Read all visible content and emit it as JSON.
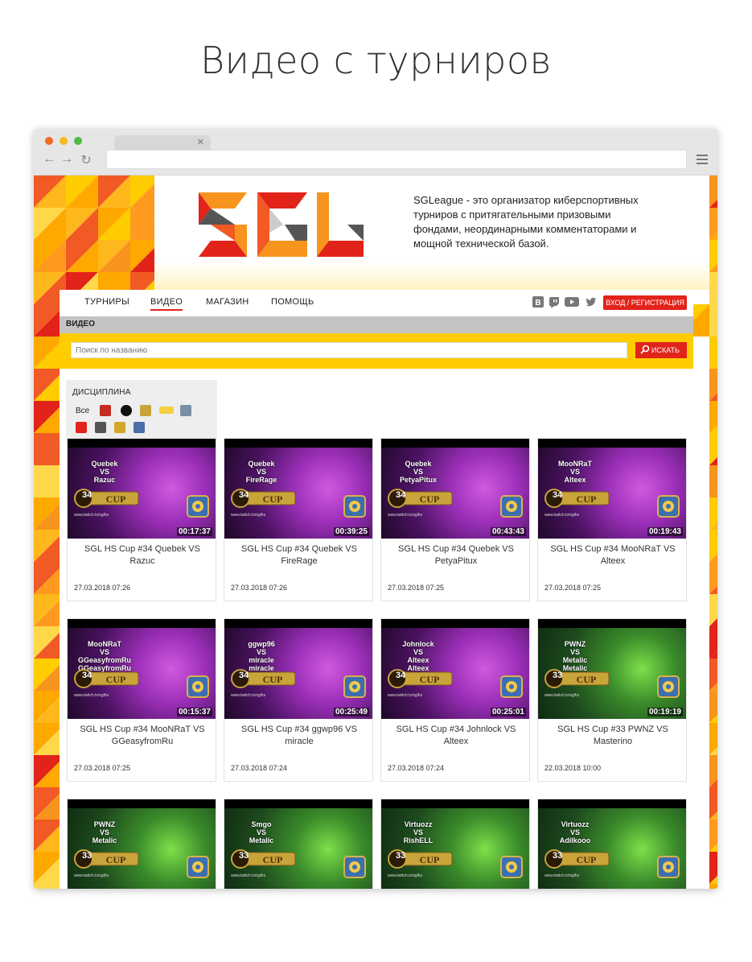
{
  "heading": "Видео с турниров",
  "site": {
    "tagline": "SGLeague - это организатор киберспортивных турниров с притягательными призовыми фондами, неординарными комментаторами и мощной технической базой.",
    "nav": [
      "ТУРНИРЫ",
      "ВИДЕО",
      "МАГАЗИН",
      "ПОМОЩЬ"
    ],
    "login_label": "ВХОД / РЕГИСТРАЦИЯ",
    "section_title": "ВИДЕО",
    "search_placeholder": "Поиск по названию",
    "search_label": "ИСКАТЬ",
    "filter_title": "ДИСЦИПЛИНА",
    "filter_all": "Все",
    "brand_color": "#e2231a",
    "accent_yellow": "#ffcc00"
  },
  "videos": [
    {
      "p1": "Quebek",
      "vs": "VS",
      "p2": "Razuc",
      "p3": "",
      "cup": "34",
      "duration": "00:17:37",
      "title": "SGL HS Cup #34 Quebek VS Razuc",
      "date": "27.03.2018 07:26",
      "theme": "purple"
    },
    {
      "p1": "Quebek",
      "vs": "VS",
      "p2": "FireRage",
      "p3": "",
      "cup": "34",
      "duration": "00:39:25",
      "title": "SGL HS Cup #34 Quebek VS FireRage",
      "date": "27.03.2018 07:26",
      "theme": "purple"
    },
    {
      "p1": "Quebek",
      "vs": "VS",
      "p2": "PetyaPitux",
      "p3": "",
      "cup": "34",
      "duration": "00:43:43",
      "title": "SGL HS Cup #34 Quebek VS PetyaPitux",
      "date": "27.03.2018 07:25",
      "theme": "purple"
    },
    {
      "p1": "MooNRaT",
      "vs": "VS",
      "p2": "Alteex",
      "p3": "",
      "cup": "34",
      "duration": "00:19:43",
      "title": "SGL HS Cup #34 MooNRaT VS Alteex",
      "date": "27.03.2018 07:25",
      "theme": "purple"
    },
    {
      "p1": "MooNRaT",
      "vs": "VS",
      "p2": "GGeasyfromRu",
      "p3": "GGeasyfromRu",
      "cup": "34",
      "duration": "00:15:37",
      "title": "SGL HS Cup #34 MooNRaT VS GGeasyfromRu",
      "date": "27.03.2018 07:25",
      "theme": "purple"
    },
    {
      "p1": "ggwp96",
      "vs": "VS",
      "p2": "miracle",
      "p3": "miracle",
      "cup": "34",
      "duration": "00:25:49",
      "title": "SGL HS Cup #34 ggwp96 VS miracle",
      "date": "27.03.2018 07:24",
      "theme": "purple"
    },
    {
      "p1": "Johnlock",
      "vs": "VS",
      "p2": "Alteex",
      "p3": "Alteex",
      "cup": "34",
      "duration": "00:25:01",
      "title": "SGL HS Cup #34 Johnlock VS Alteex",
      "date": "27.03.2018 07:24",
      "theme": "purple"
    },
    {
      "p1": "PWNZ",
      "vs": "VS",
      "p2": "Metalic",
      "p3": "Metalic",
      "cup": "33",
      "duration": "00:19:19",
      "title": "SGL HS Cup #33 PWNZ VS Masterino",
      "date": "22.03.2018 10:00",
      "theme": "green"
    },
    {
      "p1": "PWNZ",
      "vs": "VS",
      "p2": "Metalic",
      "p3": "",
      "cup": "33",
      "duration": "",
      "title": "",
      "date": "",
      "theme": "green"
    },
    {
      "p1": "Smgo",
      "vs": "VS",
      "p2": "Metalic",
      "p3": "",
      "cup": "33",
      "duration": "",
      "title": "",
      "date": "",
      "theme": "green"
    },
    {
      "p1": "Virtuozz",
      "vs": "VS",
      "p2": "RishELL",
      "p3": "",
      "cup": "33",
      "duration": "",
      "title": "",
      "date": "",
      "theme": "green"
    },
    {
      "p1": "Virtuozz",
      "vs": "VS",
      "p2": "Adilkooo",
      "p3": "",
      "cup": "33",
      "duration": "",
      "title": "",
      "date": "",
      "theme": "green"
    }
  ],
  "video_url_mini": "www.twitch.tv/sglhs"
}
